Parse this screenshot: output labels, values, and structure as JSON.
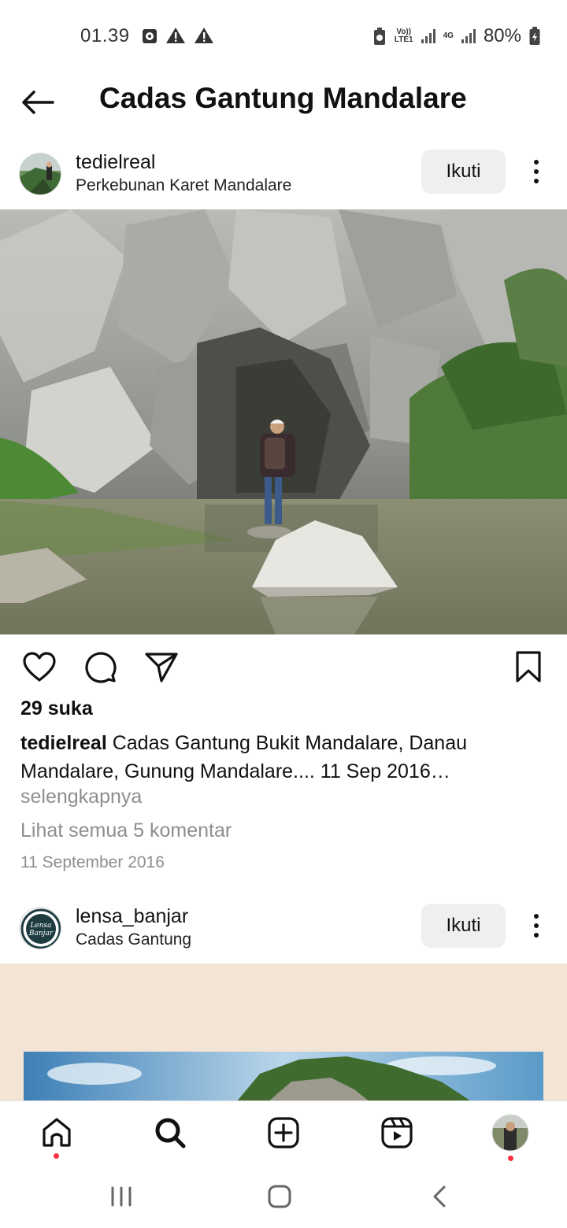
{
  "status_bar": {
    "time": "01.39",
    "network_label_top": "Vo))",
    "network_label_bottom": "LTE1",
    "network_4g": "4G",
    "battery": "80%"
  },
  "header": {
    "title": "Cadas Gantung Mandalare"
  },
  "posts": [
    {
      "username": "tedielreal",
      "location": "Perkebunan Karet Mandalare",
      "follow_label": "Ikuti",
      "likes": "29 suka",
      "caption_user": "tedielreal",
      "caption_text": " Cadas Gantung Bukit Mandalare, Danau Mandalare, Gunung Mandalare.... 11 Sep 2016…",
      "more_label": "selengkapnya",
      "comments_label": "Lihat semua 5 komentar",
      "date": "11 September 2016"
    },
    {
      "username": "lensa_banjar",
      "location": "Cadas Gantung",
      "follow_label": "Ikuti",
      "avatar_text_1": "Lensa",
      "avatar_text_2": "Banjar"
    }
  ],
  "bottom_nav": {
    "items": [
      "home-icon",
      "search-icon",
      "create-icon",
      "reels-icon",
      "profile-avatar"
    ],
    "active": "search-icon"
  },
  "colors": {
    "follow_bg": "#efefef",
    "secondary_text": "#8e8e8e",
    "notification_dot": "#ff3040"
  }
}
